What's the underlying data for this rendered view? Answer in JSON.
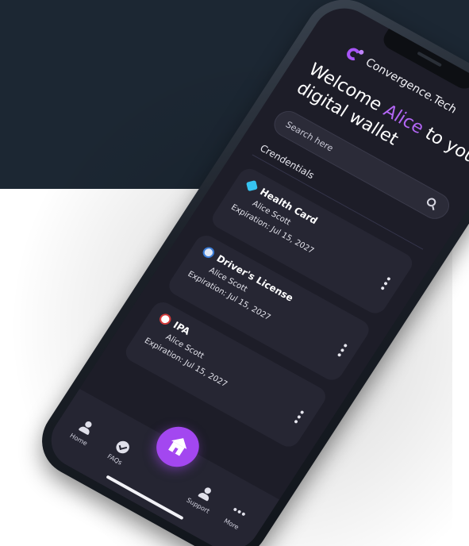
{
  "colors": {
    "background_top": "#1c2733",
    "background_bottom": "#ffffff",
    "screen": "#1d1d28",
    "accent": "#a347f0"
  },
  "brand": {
    "logo_icon": "convergence-logo-icon",
    "name": "Convergence.Tech"
  },
  "welcome": {
    "prefix": "Welcome ",
    "name": "Alice",
    "suffix": " to your digital wallet"
  },
  "search": {
    "placeholder": "Search here",
    "icon": "search-icon"
  },
  "credentials": {
    "title": "Crendentials",
    "items": [
      {
        "icon": "health-card-icon",
        "title": "Health Card",
        "holder": "Alice Scott",
        "expiration": "Expiration: Jul 15, 2027"
      },
      {
        "icon": "drivers-license-icon",
        "title": "Driver's License",
        "holder": "Alice Scott",
        "expiration": "Expiration: Jul 15, 2027"
      },
      {
        "icon": "ipa-icon",
        "title": "IPA",
        "holder": "Alice Scott",
        "expiration": "Expiration: Jul 15, 2027"
      }
    ]
  },
  "tabbar": {
    "home_label": "Home",
    "faqs_label": "FAQs",
    "support_label": "Support",
    "more_label": "More",
    "center_icon": "home-icon"
  }
}
